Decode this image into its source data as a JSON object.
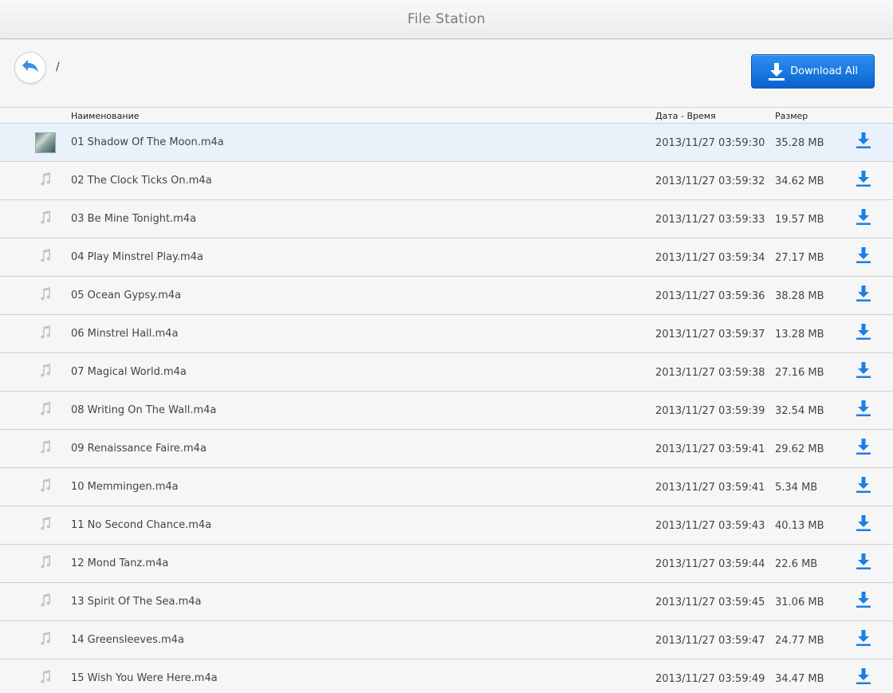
{
  "app": {
    "title": "File Station"
  },
  "path": {
    "current": "/"
  },
  "toolbar": {
    "download_all_label": "Download All"
  },
  "columns": {
    "name": "Наименование",
    "datetime": "Дата - Время",
    "size": "Размер"
  },
  "colors": {
    "accent": "#1a7fe6",
    "selected_row": "#e9f1fb"
  },
  "files": [
    {
      "name": "01 Shadow Of The Moon.m4a",
      "datetime": "2013/11/27 03:59:30",
      "size": "35.28 MB",
      "icon": "album-thumbnail",
      "selected": true
    },
    {
      "name": "02 The Clock Ticks On.m4a",
      "datetime": "2013/11/27 03:59:32",
      "size": "34.62 MB",
      "icon": "music-note-icon"
    },
    {
      "name": "03 Be Mine Tonight.m4a",
      "datetime": "2013/11/27 03:59:33",
      "size": "19.57 MB",
      "icon": "music-note-icon"
    },
    {
      "name": "04 Play Minstrel Play.m4a",
      "datetime": "2013/11/27 03:59:34",
      "size": "27.17 MB",
      "icon": "music-note-icon"
    },
    {
      "name": "05 Ocean Gypsy.m4a",
      "datetime": "2013/11/27 03:59:36",
      "size": "38.28 MB",
      "icon": "music-note-icon"
    },
    {
      "name": "06 Minstrel Hall.m4a",
      "datetime": "2013/11/27 03:59:37",
      "size": "13.28 MB",
      "icon": "music-note-icon"
    },
    {
      "name": "07 Magical World.m4a",
      "datetime": "2013/11/27 03:59:38",
      "size": "27.16 MB",
      "icon": "music-note-icon"
    },
    {
      "name": "08 Writing On The Wall.m4a",
      "datetime": "2013/11/27 03:59:39",
      "size": "32.54 MB",
      "icon": "music-note-icon"
    },
    {
      "name": "09 Renaissance Faire.m4a",
      "datetime": "2013/11/27 03:59:41",
      "size": "29.62 MB",
      "icon": "music-note-icon"
    },
    {
      "name": "10 Memmingen.m4a",
      "datetime": "2013/11/27 03:59:41",
      "size": "5.34 MB",
      "icon": "music-note-icon"
    },
    {
      "name": "11 No Second Chance.m4a",
      "datetime": "2013/11/27 03:59:43",
      "size": "40.13 MB",
      "icon": "music-note-icon"
    },
    {
      "name": "12 Mond Tanz.m4a",
      "datetime": "2013/11/27 03:59:44",
      "size": "22.6 MB",
      "icon": "music-note-icon"
    },
    {
      "name": "13 Spirit Of The Sea.m4a",
      "datetime": "2013/11/27 03:59:45",
      "size": "31.06 MB",
      "icon": "music-note-icon"
    },
    {
      "name": "14 Greensleeves.m4a",
      "datetime": "2013/11/27 03:59:47",
      "size": "24.77 MB",
      "icon": "music-note-icon"
    },
    {
      "name": "15 Wish You Were Here.m4a",
      "datetime": "2013/11/27 03:59:49",
      "size": "34.47 MB",
      "icon": "music-note-icon"
    }
  ]
}
